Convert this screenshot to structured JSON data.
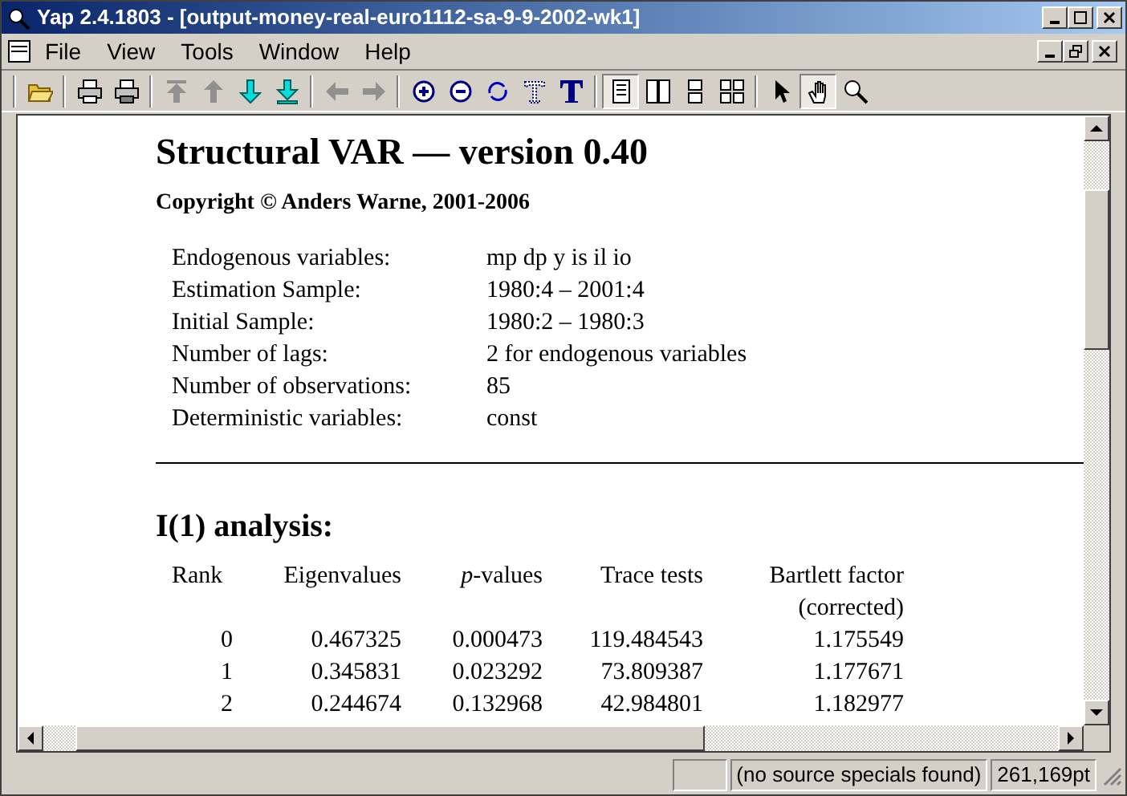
{
  "window": {
    "title": "Yap 2.4.1803 - [output-money-real-euro1112-sa-9-9-2002-wk1]"
  },
  "menu": [
    "File",
    "View",
    "Tools",
    "Window",
    "Help"
  ],
  "toolbar": [
    {
      "selected": false
    },
    {
      "selected": false
    },
    {
      "selected": false
    },
    {
      "selected": false
    },
    {
      "selected": false
    },
    {
      "selected": false
    },
    {
      "selected": false
    },
    {
      "selected": false
    },
    {
      "selected": false
    },
    {
      "selected": false
    },
    {
      "selected": false
    },
    {
      "selected": false
    },
    {
      "selected": false
    },
    {
      "selected": false
    },
    {
      "selected": true
    },
    {
      "selected": false
    },
    {
      "selected": false
    },
    {
      "selected": false
    },
    {
      "selected": false
    },
    {
      "selected": true
    },
    {
      "selected": false
    }
  ],
  "document": {
    "title": "Structural VAR — version 0.40",
    "copyright": "Copyright © Anders Warne, 2001-2006",
    "info": [
      {
        "label": "Endogenous variables:",
        "value": "mp dp y is il io"
      },
      {
        "label": "Estimation Sample:",
        "value": "1980:4 – 2001:4"
      },
      {
        "label": "Initial Sample:",
        "value": "1980:2 – 1980:3"
      },
      {
        "label": "Number of lags:",
        "value": "2 for endogenous variables"
      },
      {
        "label": "Number of observations:",
        "value": "85"
      },
      {
        "label": "Deterministic variables:",
        "value": "const"
      }
    ],
    "section": "I(1) analysis:",
    "table": {
      "columns": [
        "Rank",
        "Eigenvalues",
        "*p*-values",
        "Trace tests",
        "Bartlett factor (corrected)"
      ],
      "rows": [
        [
          "0",
          "0.467325",
          "0.000473",
          "119.484543",
          "1.175549"
        ],
        [
          "1",
          "0.345831",
          "0.023292",
          "73.809387",
          "1.177671"
        ],
        [
          "2",
          "0.244674",
          "0.132968",
          "42.984801",
          "1.182977"
        ]
      ]
    }
  },
  "status_bar": {
    "panes": [
      "(no source specials found)",
      "261,169pt"
    ]
  }
}
